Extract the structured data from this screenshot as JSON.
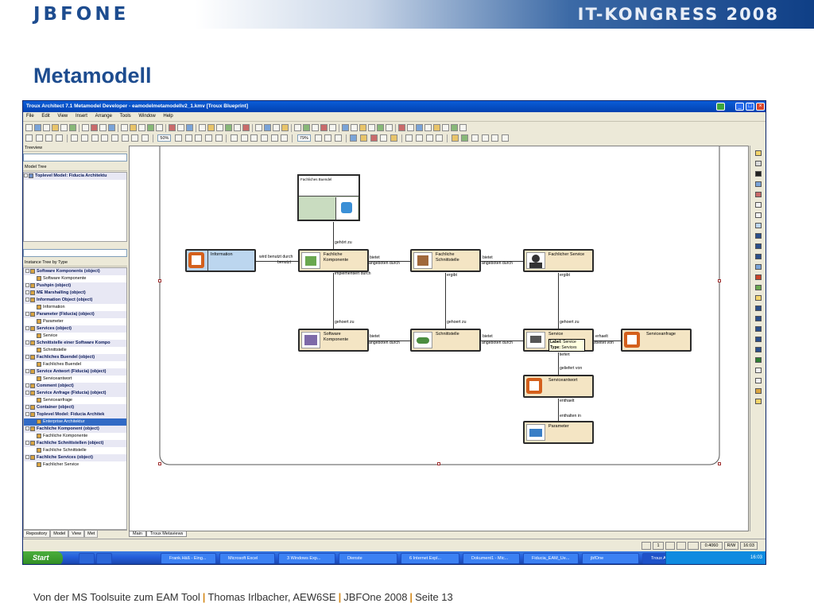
{
  "slide": {
    "logo": "JBFONE",
    "event": "IT-KONGRESS 2008",
    "title": "Metamodell",
    "footer": {
      "part1": "Von der MS Toolsuite zum EAM Tool",
      "part2": "Thomas Irlbacher, AEW6SE",
      "part3": "JBFOne 2008",
      "part4": "Seite 13"
    }
  },
  "app": {
    "window_title": "Troux Architect 7.1 Metamodel Developer - eamodelmetamodellv2_1.kmv [Troux Blueprint]",
    "menu": [
      "File",
      "Edit",
      "View",
      "Insert",
      "Arrange",
      "Tools",
      "Window",
      "Help"
    ],
    "zoom_combo_1": "50%",
    "zoom_combo_2": "79%",
    "treeview_label": "Treeview",
    "model_tree_label": "Model Tree",
    "model_tree_root": "Toplevel Model: Fiducia Architektu",
    "instance_tree_label": "Instance Tree by Type",
    "instance_tree": [
      {
        "text": "Software Komponents (object)",
        "kind": "obj"
      },
      {
        "text": "Software Komponente",
        "kind": "child"
      },
      {
        "text": "Pushpin (object)",
        "kind": "obj"
      },
      {
        "text": "ME Marshalling (object)",
        "kind": "obj"
      },
      {
        "text": "Information Object (object)",
        "kind": "obj"
      },
      {
        "text": "Information",
        "kind": "child"
      },
      {
        "text": "Parameter (Fiducia) (object)",
        "kind": "obj"
      },
      {
        "text": "Parameter",
        "kind": "child"
      },
      {
        "text": "Services (object)",
        "kind": "obj"
      },
      {
        "text": "Service",
        "kind": "child"
      },
      {
        "text": "Schnittstelle einer Software Kompo",
        "kind": "obj"
      },
      {
        "text": "Schnittstelle",
        "kind": "child"
      },
      {
        "text": "Fachliches Buendel (object)",
        "kind": "obj"
      },
      {
        "text": "Fachliches Buendel",
        "kind": "child"
      },
      {
        "text": "Service Antwort (Fiducia) (object)",
        "kind": "obj"
      },
      {
        "text": "Serviceantwort",
        "kind": "child"
      },
      {
        "text": "Comment (object)",
        "kind": "obj"
      },
      {
        "text": "Service Anfrage (Fiducia) (object)",
        "kind": "obj"
      },
      {
        "text": "Serviceanfrage",
        "kind": "child"
      },
      {
        "text": "Container (object)",
        "kind": "obj"
      },
      {
        "text": "Toplevel Model: Fiducia Architek",
        "kind": "obj"
      },
      {
        "text": "Enterprise Architektur",
        "kind": "sel"
      },
      {
        "text": "Fachliche Komponent (object)",
        "kind": "obj"
      },
      {
        "text": "Fachliche Komponente",
        "kind": "child"
      },
      {
        "text": "Fachliche Schnittstellen (object)",
        "kind": "obj"
      },
      {
        "text": "Fachliche Schnittstelle",
        "kind": "child"
      },
      {
        "text": "Fachliche Services (object)",
        "kind": "obj"
      },
      {
        "text": "Fachlicher Service",
        "kind": "child"
      }
    ],
    "left_tabs": [
      "Repository",
      "Model",
      "View",
      "Met"
    ],
    "canvas_tabs": [
      "Main",
      "Troux Metaviews"
    ],
    "status": {
      "page": "1",
      "zoom_value": "0.4060",
      "mode": "R/W",
      "time": "16:03"
    },
    "taskbar": {
      "start": "Start",
      "tasks": [
        "Frank.Häß - Eing...",
        "Microsoft Excel",
        "3 Windows Exp...",
        "Dienste",
        "6 Internet Expl...",
        "Dokument1 - Mic...",
        "Fiducia_EAM_Ue...",
        "jbfOne",
        "Troux Architect ..."
      ],
      "clock": "16:03"
    },
    "diagram": {
      "nodes": {
        "fachliches_buendel": "Fachliches Buendel",
        "information": "Information",
        "fachliche_komponente": "Fachliche Komponente",
        "fachliche_schnittstelle": "Fachliche Schnittstelle",
        "fachlicher_service": "Fachlicher Service",
        "software_komponente": "Software Komponente",
        "schnittstelle": "Schnittstelle",
        "service": "Service",
        "serviceanfrage": "Serviceanfrage",
        "serviceantwort": "Serviceantwort",
        "parameter": "Parameter"
      },
      "service_tooltip": {
        "label_key": "Label:",
        "label_val": "Service",
        "type_key": "Type:",
        "type_val": "Services"
      },
      "edge_labels": {
        "gehoert_zu_top": "gehört zu",
        "wird_benutzt": "wird benutzt durch",
        "benutzt": "benutzt",
        "bietet_1": "bietet",
        "wird_angeboten_1": "wird angeboten durch",
        "bietet_2": "bietet",
        "wird_angeboten_2": "wird angeboten durch",
        "implementiert": "implementiert durch",
        "ergibt_1": "ergibt",
        "ergibt_2": "ergibt",
        "gehoert_zu_1": "gehoert zu",
        "gehoert_zu_2": "gehoert zu",
        "gehoert_zu_3": "gehoert zu",
        "bietet_3": "bietet",
        "wird_angeboten_3": "wird angeboten durch",
        "bietet_4": "bietet",
        "wird_angeboten_4": "wird angeboten durch",
        "erhaelt": "erhaelt",
        "bearbeitet": "bearbeitet von",
        "liefert": "liefert",
        "geliefert": "geliefert von",
        "enthaelt": "enthaelt",
        "enthalten": "enthalten in"
      }
    }
  }
}
